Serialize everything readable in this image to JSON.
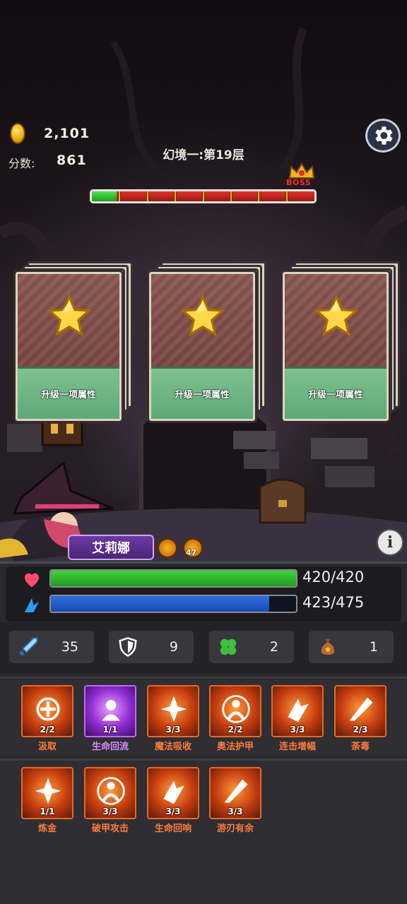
{
  "hud": {
    "coins": "2,101",
    "score_label": "分数:",
    "score": "861",
    "level_title": "幻境一:第19层",
    "boss_label": "BOSS",
    "progress": 0.11,
    "progress_ticks": 7
  },
  "cards": [
    {
      "label": "升级一项属性",
      "icon": "star-icon"
    },
    {
      "label": "升级一项属性",
      "icon": "star-icon"
    },
    {
      "label": "升级一项属性",
      "icon": "star-icon"
    }
  ],
  "hero": {
    "name": "艾莉娜",
    "buff_count": "47"
  },
  "stats": {
    "hp": {
      "text": "420/420",
      "current": 420,
      "max": 420,
      "color": "#3fd33a"
    },
    "mp": {
      "text": "423/475",
      "current": 423,
      "max": 475,
      "color": "#2e6fe0"
    }
  },
  "attributes": [
    {
      "icon": "sword-icon",
      "value": "35"
    },
    {
      "icon": "shield-icon",
      "value": "9"
    },
    {
      "icon": "clover-icon",
      "value": "2"
    },
    {
      "icon": "money-bag-icon",
      "value": "1"
    }
  ],
  "skills_row1": [
    {
      "name": "汲取",
      "level": "2/2",
      "color": "orange"
    },
    {
      "name": "生命回流",
      "level": "1/1",
      "color": "purple"
    },
    {
      "name": "魔法吸收",
      "level": "3/3",
      "color": "orange"
    },
    {
      "name": "奥法护甲",
      "level": "2/2",
      "color": "orange"
    },
    {
      "name": "连击增幅",
      "level": "3/3",
      "color": "orange"
    },
    {
      "name": "荼毒",
      "level": "2/3",
      "color": "orange"
    }
  ],
  "skills_row2": [
    {
      "name": "炼金",
      "level": "1/1",
      "color": "orange"
    },
    {
      "name": "破甲攻击",
      "level": "3/3",
      "color": "orange"
    },
    {
      "name": "生命回响",
      "level": "3/3",
      "color": "orange"
    },
    {
      "name": "游刃有余",
      "level": "3/3",
      "color": "orange"
    }
  ]
}
